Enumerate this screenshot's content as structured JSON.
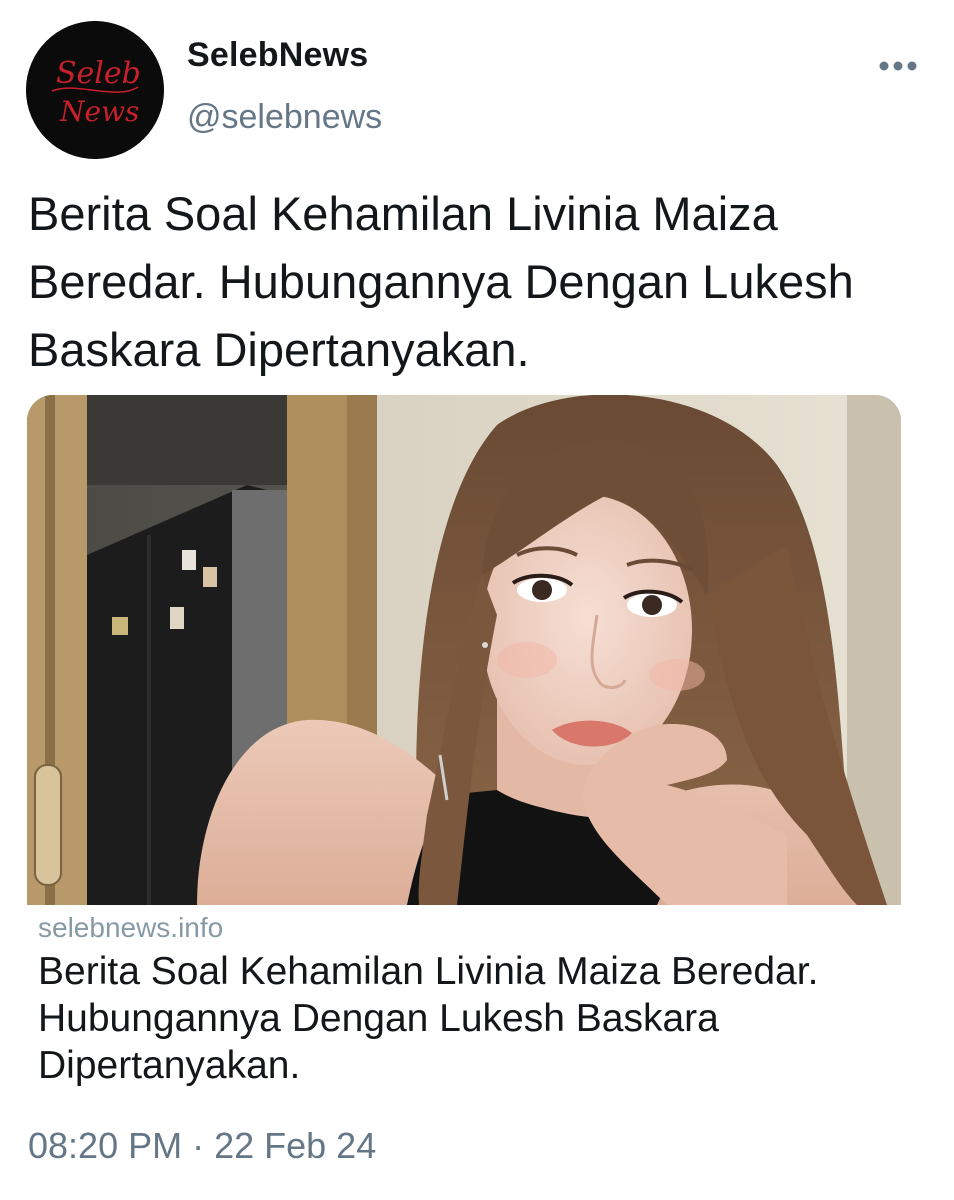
{
  "account": {
    "display_name": "SelebNews",
    "handle": "@selebnews",
    "avatar_text_top": "Seleb",
    "avatar_text_bottom": "News"
  },
  "tweet": {
    "text": "Berita Soal Kehamilan Livinia Maiza Beredar. Hubungannya Dengan Lukesh Baskara Dipertanyakan."
  },
  "card": {
    "domain": "selebnews.info",
    "title": "Berita Soal Kehamilan Livinia Maiza Beredar. Hubungannya Dengan Lukesh Baskara Dipertanyakan."
  },
  "meta": {
    "time": "08:20 PM",
    "separator": "·",
    "date": "22 Feb 24"
  },
  "icons": {
    "more": "more-horizontal-icon"
  },
  "colors": {
    "text_primary": "#14171a",
    "text_secondary": "#657786",
    "domain_text": "#8899a6",
    "avatar_bg": "#0b0b0b",
    "avatar_script": "#c8202a"
  }
}
